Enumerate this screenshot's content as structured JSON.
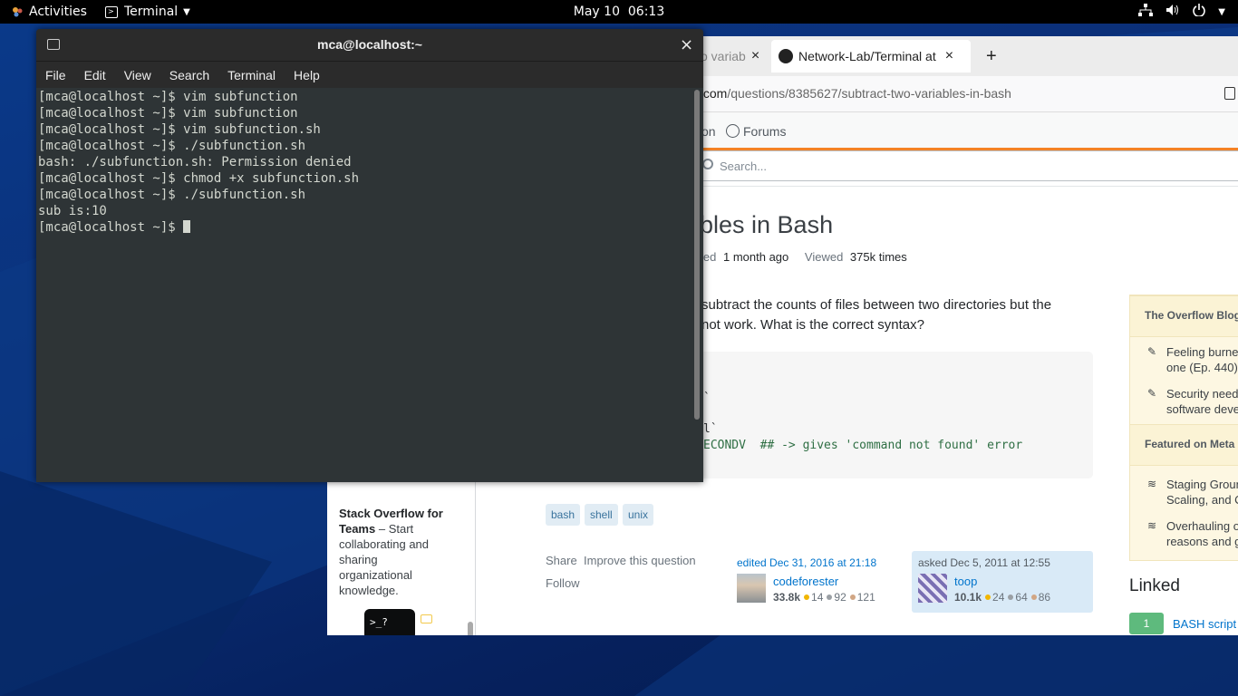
{
  "topbar": {
    "activities": "Activities",
    "app_name": "Terminal",
    "clock": "May 10  06:13"
  },
  "browser": {
    "tabs": [
      {
        "label": "o variab",
        "close": "×"
      },
      {
        "label": "Network-Lab/Terminal at",
        "close": "×"
      }
    ],
    "new_tab": "+",
    "url_domain": ".com",
    "url_path": "/questions/8385627/subtract-two-variables-in-bash",
    "nav_partial": "on",
    "nav_forums": "Forums",
    "search_placeholder": "Search...",
    "question_title": "bles in Bash",
    "meta": {
      "modified_label": "ied",
      "modified_value": "1 month ago",
      "viewed_label": "Viewed",
      "viewed_value": "375k times"
    },
    "body_lines": [
      "subtract the counts of files between two directories but the",
      "not work. What is the correct syntax?"
    ],
    "code_lines": [
      "`",
      "l`",
      "ECONDV  ## -> gives 'command not found' error"
    ],
    "tags": [
      "bash",
      "shell",
      "unix"
    ],
    "post_menu": {
      "share": "Share",
      "improve": "Improve this question",
      "follow": "Follow"
    },
    "edited": {
      "action": "edited Dec 31, 2016 at 21:18",
      "user": "codeforester",
      "rep": "33.8k",
      "gold": "14",
      "silver": "92",
      "bronze": "121"
    },
    "asked": {
      "action": "asked Dec 5, 2011 at 12:55",
      "user": "toop",
      "rep": "10.1k",
      "gold": "24",
      "silver": "64",
      "bronze": "86"
    },
    "teams_promo": {
      "title": "Stack Overflow for Teams",
      "dash": " – ",
      "text": "Start collaborating and sharing organizational knowledge.",
      "lines": [
        "Stack Overflow for",
        "Teams",
        "– Start",
        "collaborating and",
        "sharing",
        "organizational",
        "knowledge."
      ]
    },
    "terminal_icon_text": ">_?",
    "blog": {
      "head1": "The Overflow Blog",
      "items1": [
        [
          "Feeling burned",
          "one (Ep. 440)"
        ],
        [
          "Security needs",
          "software deve"
        ]
      ],
      "head2": "Featured on Meta",
      "items2": [
        [
          "Staging Groun",
          "Scaling, and C"
        ],
        [
          "Overhauling o",
          "reasons and g"
        ]
      ]
    },
    "linked": {
      "title": "Linked",
      "count": "1",
      "item": "BASH script"
    },
    "colors": {
      "accent": "#f48225",
      "tag_bg": "#e1ecf4",
      "tag_fg": "#39739d",
      "link": "#0074cc",
      "asked_bg": "#d9eaf7"
    }
  },
  "terminal": {
    "title": "mca@localhost:~",
    "close": "×",
    "menu": [
      "File",
      "Edit",
      "View",
      "Search",
      "Terminal",
      "Help"
    ],
    "lines": [
      "[mca@localhost ~]$ vim subfunction",
      "[mca@localhost ~]$ vim subfunction",
      "[mca@localhost ~]$ vim subfunction.sh",
      "[mca@localhost ~]$ ./subfunction.sh",
      "bash: ./subfunction.sh: Permission denied",
      "[mca@localhost ~]$ chmod +x subfunction.sh",
      "[mca@localhost ~]$ ./subfunction.sh",
      "sub is:10",
      "[mca@localhost ~]$ "
    ]
  }
}
